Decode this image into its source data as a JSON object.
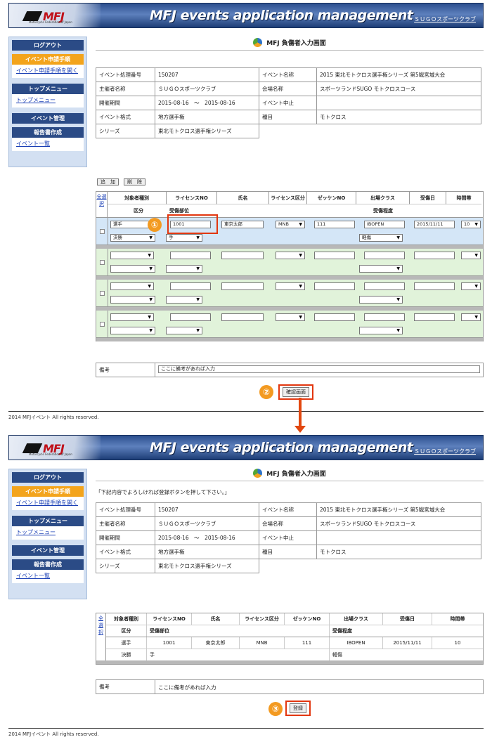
{
  "header": {
    "logo_text": "MFJ",
    "logo_sub": "Motorcycle Federation of Japan",
    "title": "MFJ events application management",
    "club": "ＳＵＧＯスポーツクラブ"
  },
  "sidebar": {
    "logout": "ログアウト",
    "event_procedure": "イベント申請手順",
    "event_procedure_link": "イベント申請手順を開く",
    "top_menu": "トップメニュー",
    "top_menu_link": "トップメニュー",
    "event_admin": "イベント管理",
    "report": "報告書作成",
    "event_list": "イベント一覧"
  },
  "page_title": "MFJ 負傷者入力画面",
  "confirm_notice": "「下記内容でよろしければ登録ボタンを押して下さい。」",
  "info": {
    "rows": [
      [
        "イベント処理番号",
        "150207",
        "イベント名称",
        "2015 東北モトクロス選手権シリーズ 第5戦宮城大会"
      ],
      [
        "主催者名称",
        "ＳＵＧＯスポーツクラブ",
        "会場名称",
        "スポーツランドSUGO モトクロスコース"
      ],
      [
        "開催期間",
        "2015-08-16　～　2015-08-16",
        "イベント中止",
        ""
      ],
      [
        "イベント格式",
        "地方選手権",
        "種目",
        "モトクロス"
      ],
      [
        "シリーズ",
        "東北モトクロス選手権シリーズ"
      ]
    ]
  },
  "buttons": {
    "add": "追　加",
    "delete": "削　除",
    "confirm": "確認画面",
    "register": "登録"
  },
  "grid": {
    "select_all": "全選択",
    "headers_top": [
      "対象者種別",
      "ライセンスNO",
      "氏名",
      "ライセンス区分",
      "ゼッケンNO",
      "出場クラス",
      "受傷日",
      "時間帯"
    ],
    "headers_bottom": [
      "区分",
      "受傷部位",
      "受傷程度"
    ],
    "entry": {
      "type": "選手",
      "license_no": "1001",
      "name": "東京太郎",
      "license_class": "MNB",
      "bib": "111",
      "class": "IBOPEN",
      "date": "2015/11/11",
      "time": "10",
      "division": "決勝",
      "part": "手",
      "degree": "軽傷"
    }
  },
  "remarks": {
    "label": "備考",
    "value": "ここに備考があれば入力"
  },
  "footer": "2014 MFJイベント All rights reserved.",
  "steps": [
    "①",
    "②",
    "③"
  ],
  "colors": {
    "header_blue": "#2c4f8e",
    "orange": "#f3a41c",
    "highlight_red": "#e2360f"
  }
}
